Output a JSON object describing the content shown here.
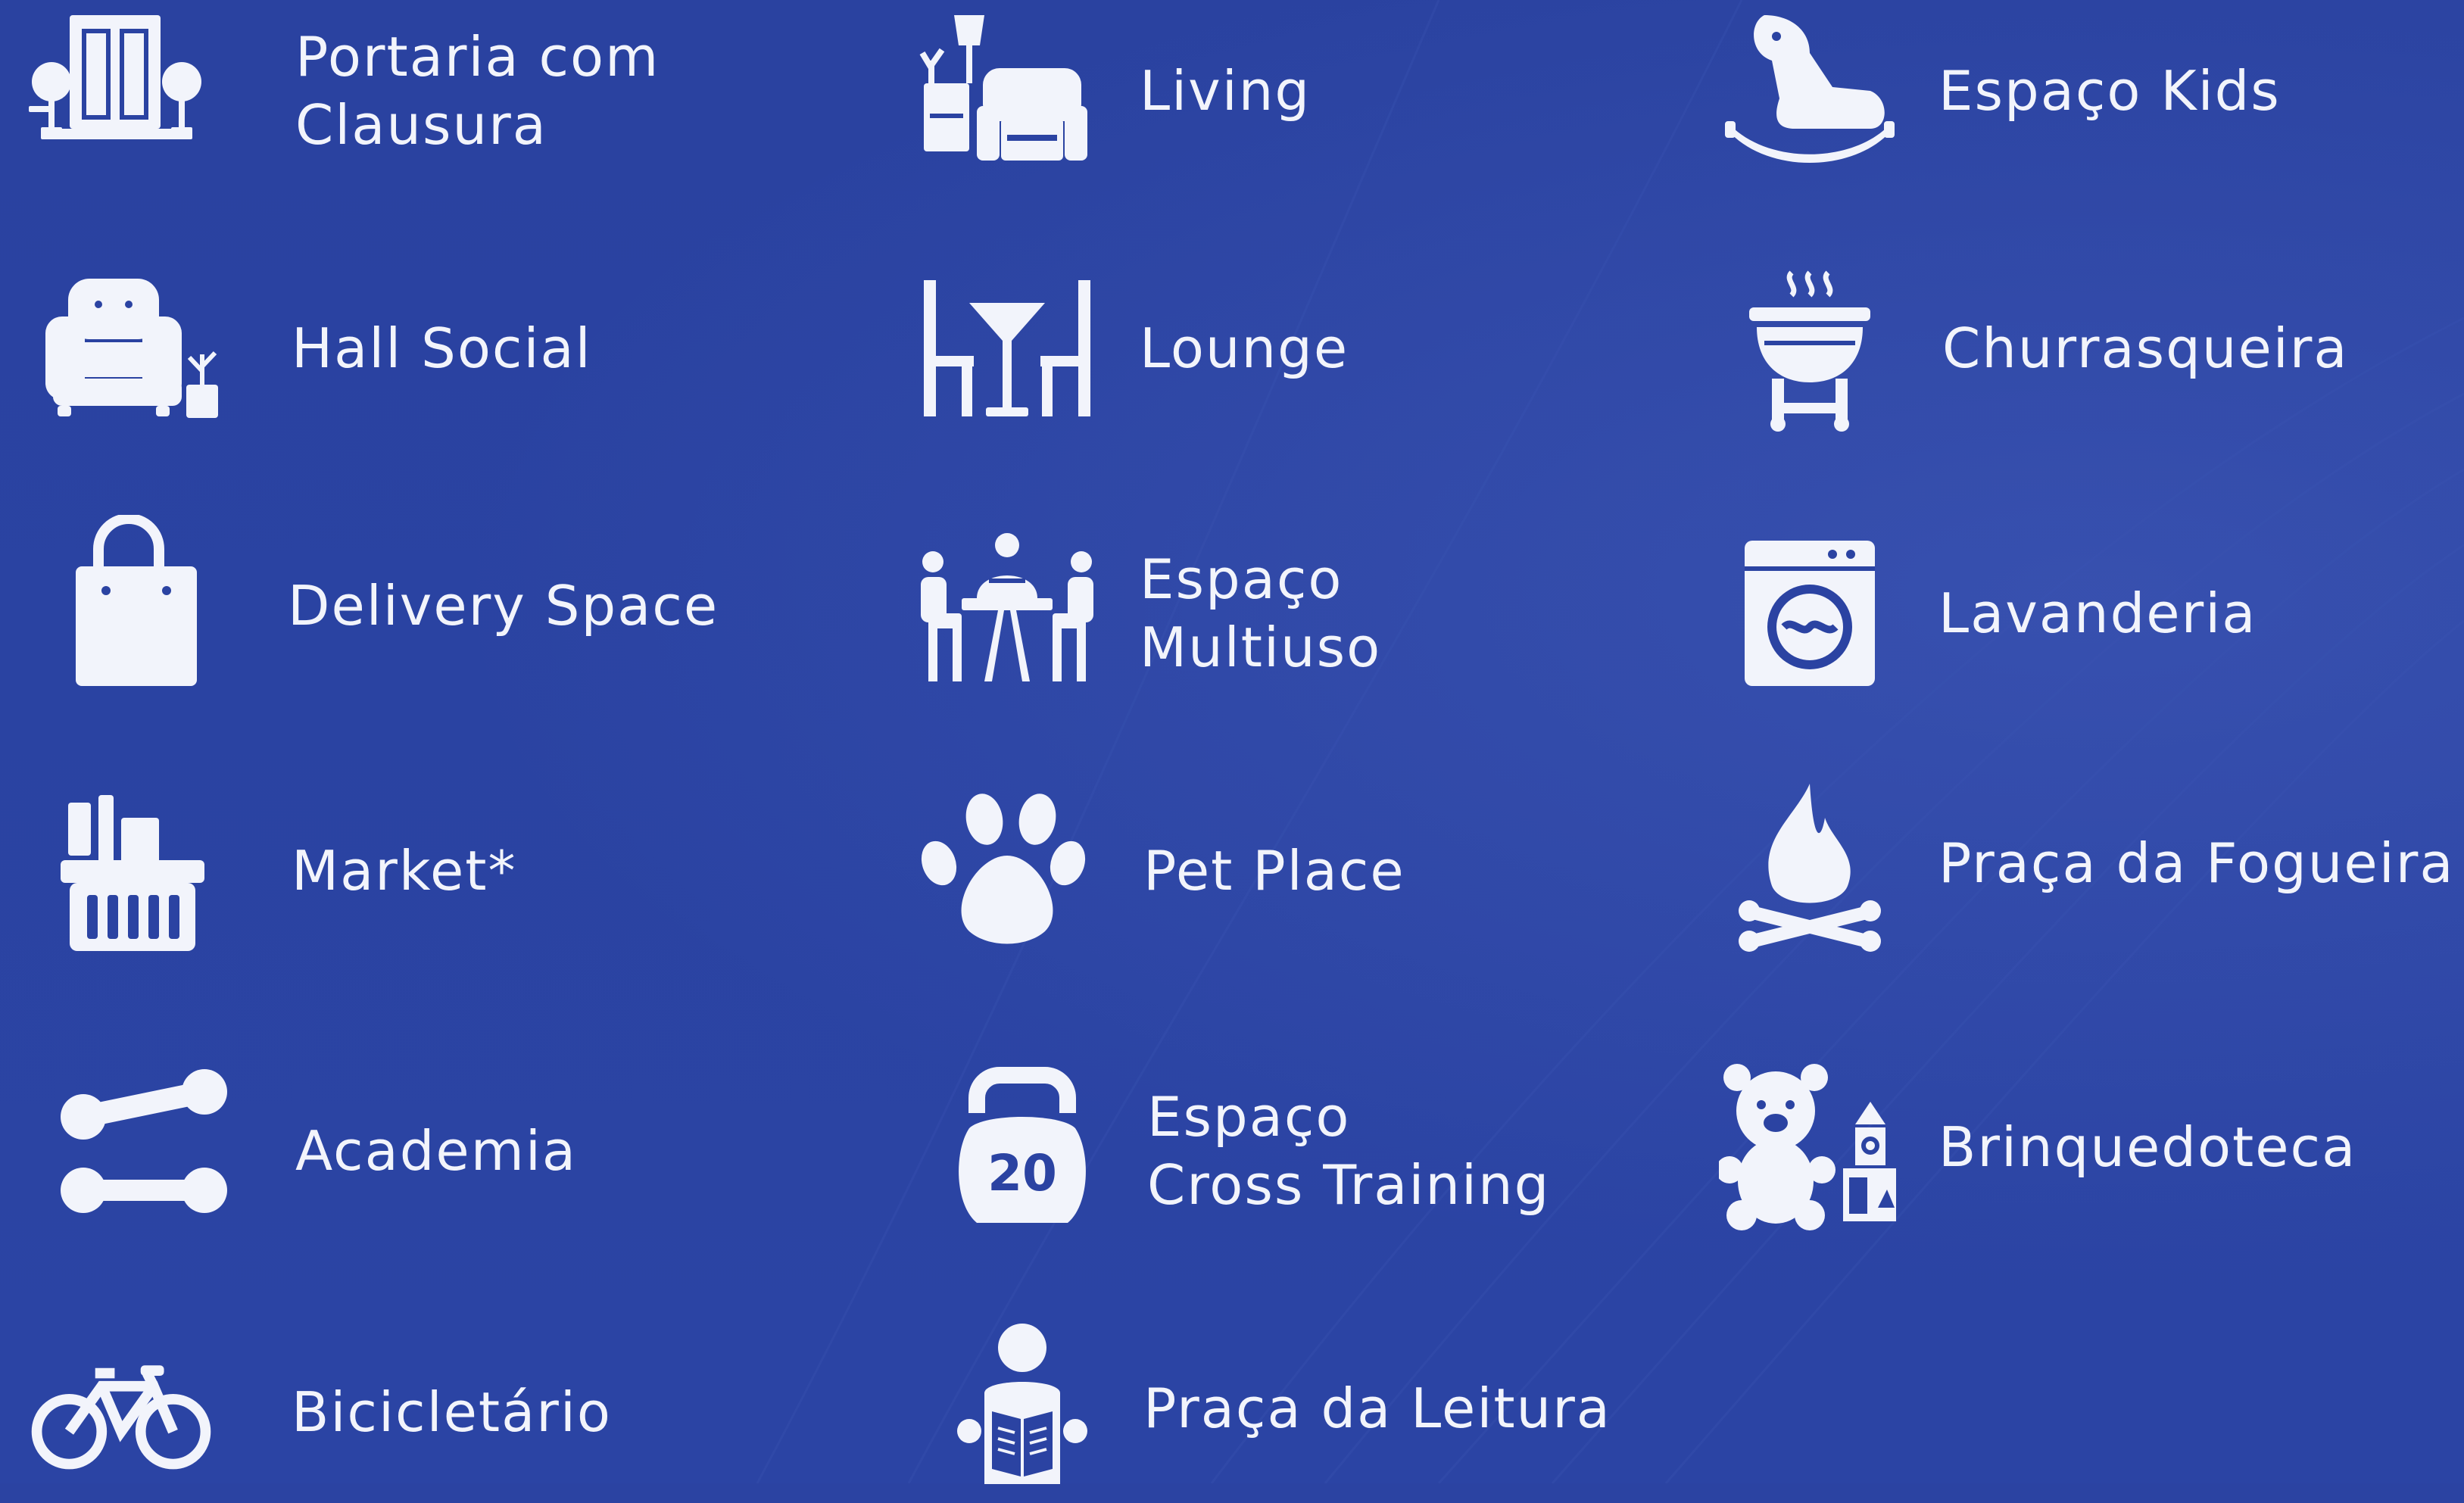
{
  "theme": {
    "background": "#2b43a2",
    "foreground": "#f2f4fb"
  },
  "amenities": [
    {
      "id": "portaria",
      "icon": "gatehouse-icon",
      "lines": [
        "Portaria com",
        "Clausura"
      ]
    },
    {
      "id": "living",
      "icon": "living-room-icon",
      "lines": [
        "Living"
      ]
    },
    {
      "id": "kids",
      "icon": "rocking-horse-icon",
      "lines": [
        "Espaço Kids"
      ]
    },
    {
      "id": "hall",
      "icon": "armchair-plant-icon",
      "lines": [
        "Hall Social"
      ]
    },
    {
      "id": "lounge",
      "icon": "lounge-table-icon",
      "lines": [
        "Lounge"
      ]
    },
    {
      "id": "churrasqueira",
      "icon": "barbecue-grill-icon",
      "lines": [
        "Churrasqueira"
      ]
    },
    {
      "id": "delivery",
      "icon": "shopping-bag-icon",
      "lines": [
        "Delivery Space"
      ]
    },
    {
      "id": "multiuso",
      "icon": "meeting-people-icon",
      "lines": [
        "Espaço",
        "Multiuso"
      ]
    },
    {
      "id": "lavanderia",
      "icon": "washing-machine-icon",
      "lines": [
        "Lavanderia"
      ]
    },
    {
      "id": "market",
      "icon": "market-basket-icon",
      "lines": [
        "Market*"
      ]
    },
    {
      "id": "pet",
      "icon": "paw-icon",
      "lines": [
        "Pet Place"
      ]
    },
    {
      "id": "fogueira",
      "icon": "campfire-icon",
      "lines": [
        "Praça da Fogueira"
      ]
    },
    {
      "id": "academia",
      "icon": "dumbbell-icon",
      "lines": [
        "Academia"
      ]
    },
    {
      "id": "cross",
      "icon": "kettlebell-icon",
      "lines": [
        "Espaço",
        "Cross Training"
      ],
      "icon_text": "20"
    },
    {
      "id": "brinquedoteca",
      "icon": "teddy-bear-icon",
      "lines": [
        "Brinquedoteca"
      ]
    },
    {
      "id": "bicicletario",
      "icon": "bicycle-icon",
      "lines": [
        "Bicicletário"
      ]
    },
    {
      "id": "leitura",
      "icon": "reading-person-icon",
      "lines": [
        "Praça da Leitura"
      ]
    }
  ]
}
